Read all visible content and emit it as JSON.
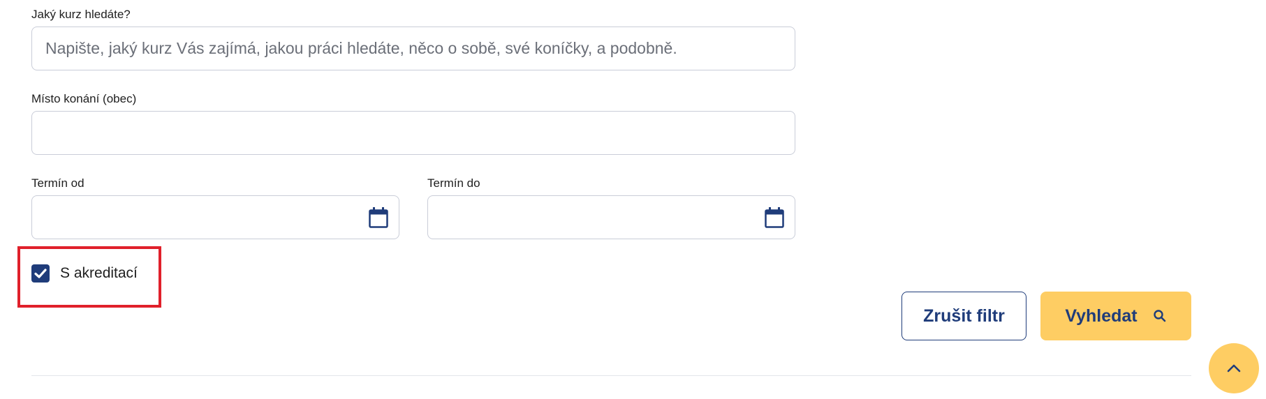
{
  "form": {
    "course_label": "Jaký kurz hledáte?",
    "course_placeholder": "Napište, jaký kurz Vás zajímá, jakou práci hledáte, něco o sobě, své koníčky, a podobně.",
    "course_value": "",
    "location_label": "Místo konání (obec)",
    "location_value": "",
    "date_from_label": "Termín od",
    "date_from_value": "",
    "date_to_label": "Termín do",
    "date_to_value": "",
    "accreditation_label": "S akreditací",
    "accreditation_checked": true
  },
  "actions": {
    "clear_label": "Zrušit filtr",
    "search_label": "Vyhledat"
  },
  "colors": {
    "primary": "#1f3c7a",
    "accent": "#fecd63",
    "highlight": "#e0202b"
  },
  "icons": {
    "date_from": "calendar-icon",
    "date_to": "calendar-icon",
    "search": "search-icon",
    "scroll_top": "chevron-up-icon",
    "checkbox": "checkmark-icon"
  }
}
